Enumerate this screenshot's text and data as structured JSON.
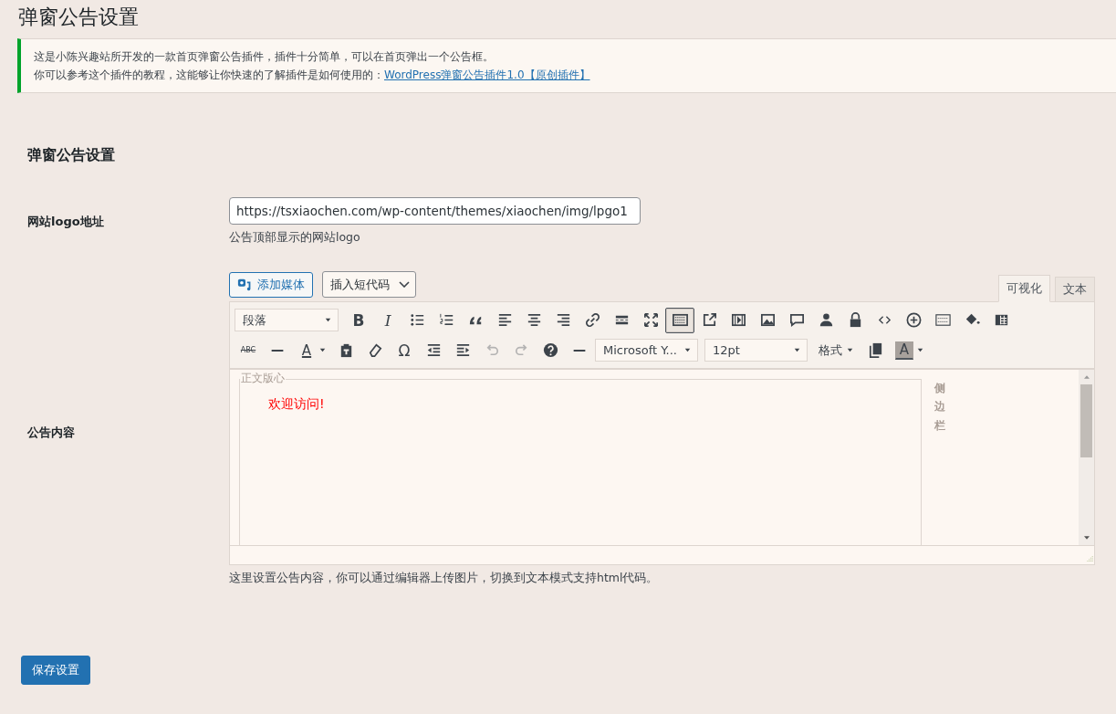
{
  "page_title": "弹窗公告设置",
  "notice": {
    "lines": [
      "这是小陈兴趣站所开发的一款首页弹窗公告插件，插件十分简单，可以在首页弹出一个公告框。",
      "你可以参考这个插件的教程，这能够让你快速的了解插件是如何使用的："
    ],
    "link": "WordPress弹窗公告插件1.0【原创插件】"
  },
  "section_title": "弹窗公告设置",
  "logo_field": {
    "label": "网站logo地址",
    "value": "https://tsxiaochen.com/wp-content/themes/xiaochen/img/lpgo1",
    "description": "公告顶部显示的网站logo"
  },
  "content_field": {
    "label": "公告内容",
    "description": "这里设置公告内容，你可以通过编辑器上传图片，切换到文本模式支持html代码。"
  },
  "editor": {
    "add_media": "添加媒体",
    "shortcode": "插入短代码",
    "tabs": [
      {
        "label": "可视化",
        "selected": true
      },
      {
        "label": "文本",
        "selected": false
      }
    ],
    "toolbar_rows": [
      [
        {
          "kind": "select",
          "label": "段落"
        },
        {
          "kind": "glyph",
          "label": "B",
          "pressed": false,
          "disabled": false
        },
        {
          "kind": "glyph",
          "label": "I",
          "pressed": false,
          "disabled": false
        },
        {
          "kind": "icon",
          "pressed": false,
          "disabled": false
        },
        {
          "kind": "icon",
          "pressed": false,
          "disabled": false
        },
        {
          "kind": "icon",
          "pressed": false,
          "disabled": false
        },
        {
          "kind": "icon",
          "pressed": false,
          "disabled": false
        },
        {
          "kind": "icon",
          "pressed": false,
          "disabled": false
        },
        {
          "kind": "icon",
          "pressed": false,
          "disabled": false
        },
        {
          "kind": "icon",
          "pressed": false,
          "disabled": false
        },
        {
          "kind": "icon",
          "pressed": false,
          "disabled": false
        },
        {
          "kind": "icon",
          "pressed": false,
          "disabled": false
        },
        {
          "kind": "icon",
          "pressed": true,
          "disabled": false
        },
        {
          "kind": "icon",
          "pressed": false,
          "disabled": false
        },
        {
          "kind": "icon",
          "pressed": false,
          "disabled": false
        },
        {
          "kind": "icon",
          "pressed": false,
          "disabled": false
        },
        {
          "kind": "icon",
          "pressed": false,
          "disabled": false
        },
        {
          "kind": "icon",
          "pressed": false,
          "disabled": false
        },
        {
          "kind": "icon",
          "pressed": false,
          "disabled": false
        },
        {
          "kind": "icon",
          "pressed": false,
          "disabled": false
        },
        {
          "kind": "icon",
          "pressed": false,
          "disabled": false
        },
        {
          "kind": "icon",
          "pressed": false,
          "disabled": false
        },
        {
          "kind": "icon",
          "pressed": false,
          "disabled": false
        },
        {
          "kind": "icon",
          "pressed": false,
          "disabled": false
        }
      ],
      [
        {
          "kind": "glyph",
          "label": "ABC",
          "pressed": false,
          "disabled": false
        },
        {
          "kind": "icon",
          "pressed": false,
          "disabled": false
        },
        {
          "kind": "split",
          "label": "A",
          "pressed": false,
          "disabled": false
        },
        {
          "kind": "icon",
          "pressed": false,
          "disabled": false
        },
        {
          "kind": "icon",
          "pressed": false,
          "disabled": false
        },
        {
          "kind": "glyph",
          "label": "Ω",
          "pressed": false,
          "disabled": false
        },
        {
          "kind": "icon",
          "pressed": false,
          "disabled": false
        },
        {
          "kind": "icon",
          "pressed": false,
          "disabled": false
        },
        {
          "kind": "icon",
          "pressed": false,
          "disabled": true
        },
        {
          "kind": "icon",
          "pressed": false,
          "disabled": true
        },
        {
          "kind": "icon",
          "pressed": false,
          "disabled": false
        },
        {
          "kind": "icon",
          "pressed": false,
          "disabled": false
        },
        {
          "kind": "select",
          "label": "Microsoft Y..."
        },
        {
          "kind": "select",
          "label": "12pt"
        },
        {
          "kind": "menu",
          "label": "格式"
        },
        {
          "kind": "icon",
          "pressed": false,
          "disabled": false
        },
        {
          "kind": "split",
          "label": "A",
          "pressed": false,
          "disabled": false
        }
      ]
    ],
    "frame_legend": "正文版心",
    "body_text": "欢迎访问!",
    "sidebar_text": "侧边栏"
  },
  "save_button": "保存设置"
}
